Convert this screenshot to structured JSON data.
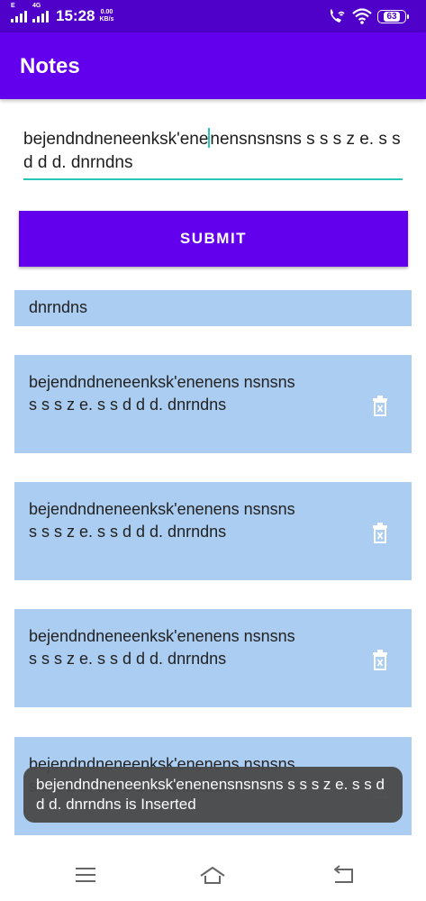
{
  "status_bar": {
    "network_type": "E",
    "network_gen": "4G",
    "time": "15:28",
    "speed_value": "0.00",
    "speed_unit": "KB/s",
    "battery": "63"
  },
  "app": {
    "title": "Notes"
  },
  "input": {
    "value_before_caret": "bejendndneneenksk'ene",
    "value_after_caret": "nensnsnsns s s s z e. s s d d d. dnrndns"
  },
  "submit": {
    "label": "SUBMIT"
  },
  "notes": [
    {
      "text": "dnrndns"
    },
    {
      "text": "bejendndneneenksk'enenens nsnsns s s s z e. s s d d d. dnrndns"
    },
    {
      "text": "bejendndneneenksk'enenens nsnsns s s s z e. s s d d d. dnrndns"
    },
    {
      "text": "bejendndneneenksk'enenens nsnsns s s s z e. s s d d d. dnrndns"
    },
    {
      "text": "bejendndneneenksk'enenens nsnsns s s s z e. s s d d d. dnrndns"
    }
  ],
  "toast": {
    "message": "bejendndneneenksk'enenensnsnsns s s s z e. s s d d d. dnrndns  is Inserted"
  },
  "icons": {
    "delete": "trash-icon",
    "menu": "menu-icon",
    "home": "home-icon",
    "back": "back-icon",
    "wifi": "wifi-icon",
    "wifi_call": "wifi-calling-icon",
    "signal": "signal-icon"
  },
  "colors": {
    "status_bar": "#4f00c9",
    "primary": "#6200ee",
    "accent": "#26c6b8",
    "card": "#abcdf1",
    "toast": "#4a4a4a"
  }
}
